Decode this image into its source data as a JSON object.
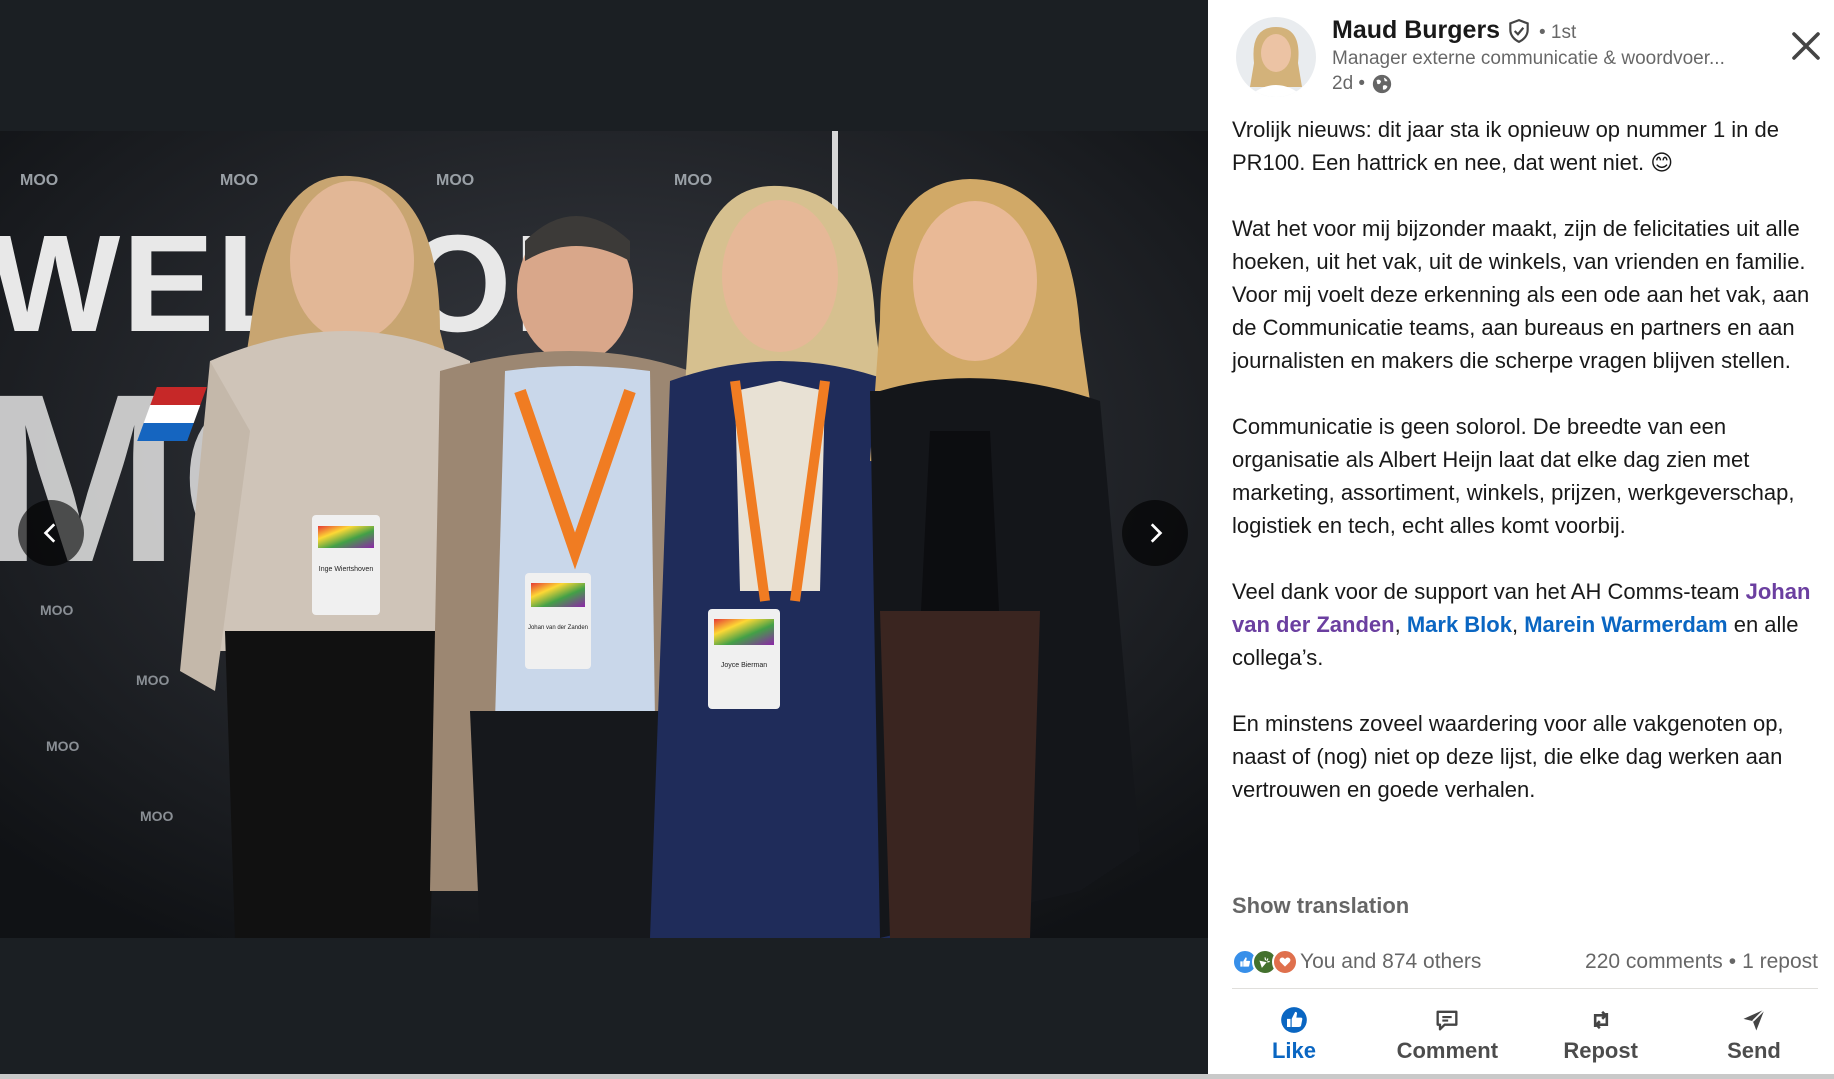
{
  "colors": {
    "link_blue": "#0a66c2",
    "visited_mention": "#6b3fa0",
    "media_background": "#1b1f23",
    "like_active": "#0a66c2"
  },
  "media": {
    "prev_icon": "chevron-left-icon",
    "next_icon": "chevron-right-icon",
    "backdrop_words": [
      "WELCOM",
      "MOO"
    ],
    "badge_names": [
      "Inge Wiertshoven",
      "Johan van der Zanden",
      "Joyce Bierman"
    ]
  },
  "post": {
    "author": {
      "name": "Maud Burgers",
      "degree": "• 1st",
      "headline": "Manager externe communicatie & woordvoer...",
      "time": "2d •",
      "verified_icon": "verified-shield-icon",
      "visibility_icon": "globe-icon"
    },
    "close_icon": "close-icon",
    "paragraphs": [
      "Vrolijk nieuws: dit jaar sta ik opnieuw op nummer 1 in de PR100. Een hattrick en nee, dat went niet. 😊",
      "Wat het voor mij bijzonder maakt, zijn de felicitaties uit alle hoeken, uit het vak, uit de winkels, van vrienden en familie. Voor mij voelt deze erkenning als een ode aan het vak, aan de Communicatie teams, aan bureaus en partners en aan journalisten en makers die scherpe vragen blijven stellen.",
      "Communicatie is geen solorol. De breedte van een organisatie als Albert Heijn laat dat elke dag zien met marketing, assortiment, winkels, prijzen, werkgeverschap, logistiek en tech, echt alles komt voorbij."
    ],
    "thanks": {
      "intro": "Veel dank voor de support van het AH Comms-team ",
      "mention_1": "Johan van der Zanden",
      "sep_1": ", ",
      "mention_2": "Mark Blok",
      "sep_2": ", ",
      "mention_3": "Marein Warmerdam",
      "outro": " en alle collega’s."
    },
    "closing": "En minstens zoveel waardering voor alle vakgenoten op, naast of (nog) niet op deze lijst, die elke dag werken aan vertrouwen en goede verhalen.",
    "show_translation": "Show translation"
  },
  "social": {
    "reaction_icons": [
      "like-reaction-icon",
      "celebrate-reaction-icon",
      "love-reaction-icon"
    ],
    "reactions_text": "You and 874 others",
    "comments": "220 comments",
    "separator": "•",
    "reposts": "1 repost"
  },
  "actions": [
    {
      "label": "Like",
      "icon": "like-icon",
      "active": true
    },
    {
      "label": "Comment",
      "icon": "comment-icon",
      "active": false
    },
    {
      "label": "Repost",
      "icon": "repost-icon",
      "active": false
    },
    {
      "label": "Send",
      "icon": "send-icon",
      "active": false
    }
  ]
}
